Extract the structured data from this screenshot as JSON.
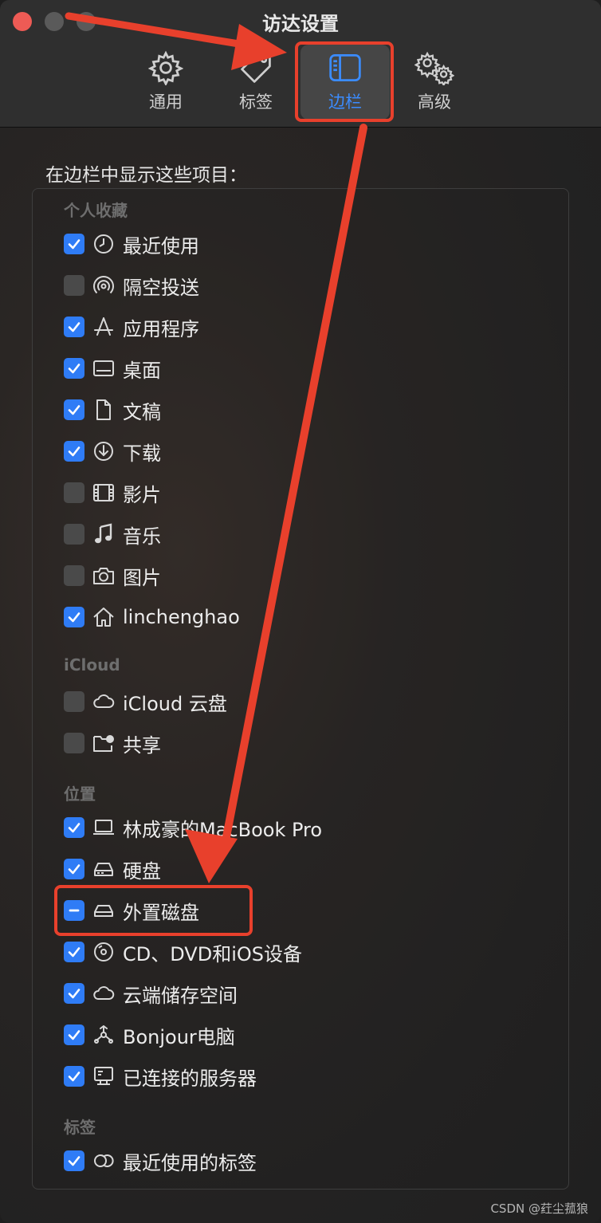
{
  "window": {
    "title": "访达设置"
  },
  "toolbar": {
    "tabs": [
      {
        "label": "通用",
        "icon": "gear-icon"
      },
      {
        "label": "标签",
        "icon": "tag-icon"
      },
      {
        "label": "边栏",
        "icon": "sidebar-icon",
        "active": true
      },
      {
        "label": "高级",
        "icon": "gears-icon"
      }
    ]
  },
  "content": {
    "heading": "在边栏中显示这些项目："
  },
  "groups": {
    "favorites": {
      "title": "个人收藏",
      "items": [
        {
          "label": "最近使用",
          "checked": true,
          "icon": "clock-icon"
        },
        {
          "label": "隔空投送",
          "checked": false,
          "icon": "airdrop-icon"
        },
        {
          "label": "应用程序",
          "checked": true,
          "icon": "applications-icon"
        },
        {
          "label": "桌面",
          "checked": true,
          "icon": "desktop-icon"
        },
        {
          "label": "文稿",
          "checked": true,
          "icon": "document-icon"
        },
        {
          "label": "下载",
          "checked": true,
          "icon": "download-icon"
        },
        {
          "label": "影片",
          "checked": false,
          "icon": "film-icon"
        },
        {
          "label": "音乐",
          "checked": false,
          "icon": "music-note-icon"
        },
        {
          "label": "图片",
          "checked": false,
          "icon": "camera-icon"
        },
        {
          "label": "linchenghao",
          "checked": true,
          "icon": "home-icon"
        }
      ]
    },
    "icloud": {
      "title": "iCloud",
      "items": [
        {
          "label": "iCloud 云盘",
          "checked": false,
          "icon": "cloud-icon"
        },
        {
          "label": "共享",
          "checked": false,
          "icon": "shared-folder-icon"
        }
      ]
    },
    "locations": {
      "title": "位置",
      "items": [
        {
          "label": "林成豪的MacBook Pro",
          "checked": true,
          "icon": "laptop-icon"
        },
        {
          "label": "硬盘",
          "checked": true,
          "icon": "hard-drive-icon"
        },
        {
          "label": "外置磁盘",
          "checked": "mixed",
          "icon": "external-drive-icon"
        },
        {
          "label": "CD、DVD和iOS设备",
          "checked": true,
          "icon": "disc-icon"
        },
        {
          "label": "云端储存空间",
          "checked": true,
          "icon": "cloud-icon"
        },
        {
          "label": "Bonjour电脑",
          "checked": true,
          "icon": "bonjour-icon"
        },
        {
          "label": "已连接的服务器",
          "checked": true,
          "icon": "server-icon"
        }
      ]
    },
    "tags": {
      "title": "标签",
      "items": [
        {
          "label": "最近使用的标签",
          "checked": true,
          "icon": "tags-circles-icon"
        }
      ]
    }
  },
  "watermark": "CSDN @荭尘菰狼",
  "colors": {
    "accent": "#2f7cf6",
    "active_tab_label": "#3b8cff",
    "annotation": "#e8402c",
    "close_button": "#ee5b55"
  }
}
